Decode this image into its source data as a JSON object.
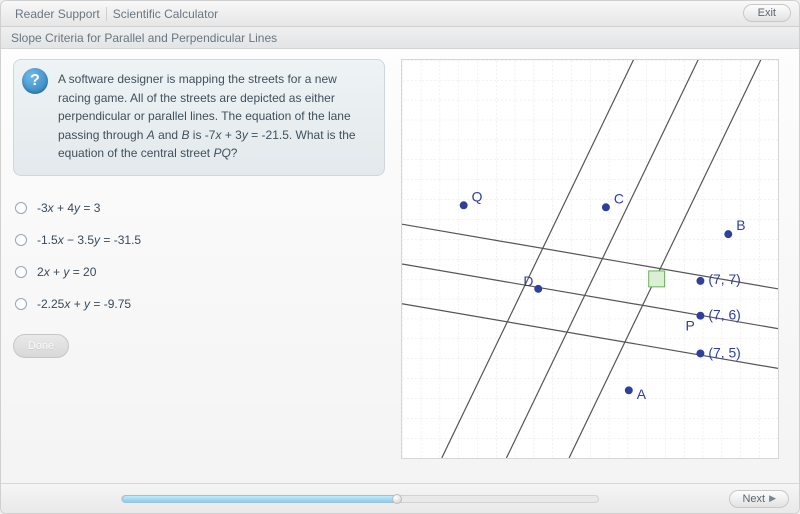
{
  "header": {
    "tab1": "Reader Support",
    "tab2": "Scientific Calculator",
    "exit_label": "Exit"
  },
  "lesson_title": "Slope Criteria for Parallel and Perpendicular Lines",
  "question": {
    "icon_glyph": "?",
    "part1": "A software designer is mapping the streets for a new racing game. All of the streets are depicted as either perpendicular or parallel lines. The equation of the lane passing through ",
    "var_A": "A",
    "mid1": " and ",
    "var_B": "B",
    "mid2": " is -7",
    "var_x1": "x",
    "mid3": " + 3",
    "var_y1": "y",
    "mid4": " = -21.5. What is the equation of the central street ",
    "var_PQ": "PQ",
    "end": "?"
  },
  "options": [
    {
      "pre": "-3",
      "vx": "x",
      "mid": " + 4",
      "vy": "y",
      "post": " = 3"
    },
    {
      "pre": "-1.5",
      "vx": "x",
      "mid": " − 3.5",
      "vy": "y",
      "post": " = -31.5"
    },
    {
      "pre": "2",
      "vx": "x",
      "mid": " + ",
      "vy": "y",
      "post": " = 20"
    },
    {
      "pre": "-2.25",
      "vx": "x",
      "mid": " + ",
      "vy": "y",
      "post": " = -9.75"
    }
  ],
  "done_label": "Done",
  "next_label": "Next",
  "graph": {
    "points": {
      "Q": {
        "label": "Q"
      },
      "C": {
        "label": "C"
      },
      "B": {
        "label": "B"
      },
      "D": {
        "label": "D"
      },
      "P": {
        "label": "P"
      },
      "A": {
        "label": "A"
      }
    },
    "coord_labels": {
      "c77": "(7, 7)",
      "c76": "(7, 6)",
      "c75": "(7, 5)"
    }
  }
}
